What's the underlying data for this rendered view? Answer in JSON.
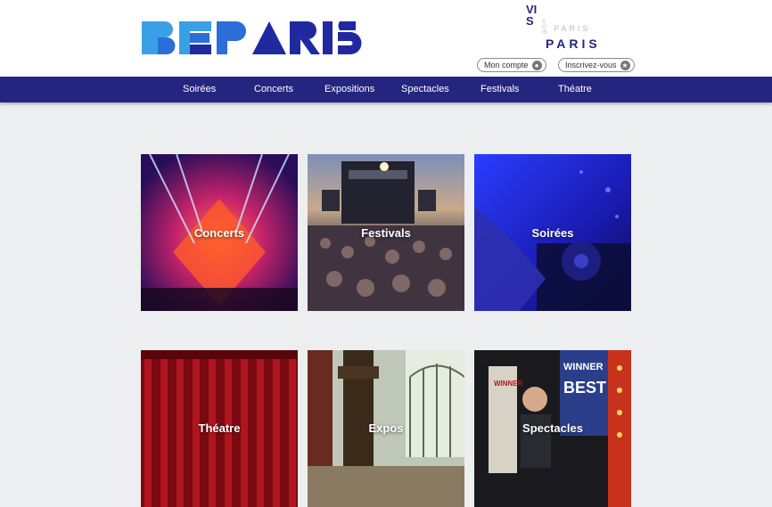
{
  "header": {
    "logo_text": "BEPARIS",
    "tagline": {
      "vis": "VIS",
      "sois": "SOIS",
      "paris_small": "PARIS",
      "paris_big": "PARIS"
    },
    "account_label": "Mon compte",
    "signup_label": "Inscrivez-vous"
  },
  "nav": {
    "items": [
      "Soirées",
      "Concerts",
      "Expositions",
      "Spectacles",
      "Festivals",
      "Théatre"
    ]
  },
  "cards": [
    {
      "label": "Concerts"
    },
    {
      "label": "Festivals"
    },
    {
      "label": "Soirées"
    },
    {
      "label": "Théatre"
    },
    {
      "label": "Expos"
    },
    {
      "label": "Spectacles"
    }
  ],
  "colors": {
    "brand_blue": "#24257f",
    "logo_light": "#3aa0e6",
    "logo_mid": "#2b6ed8",
    "logo_dark": "#1f2aa0"
  }
}
